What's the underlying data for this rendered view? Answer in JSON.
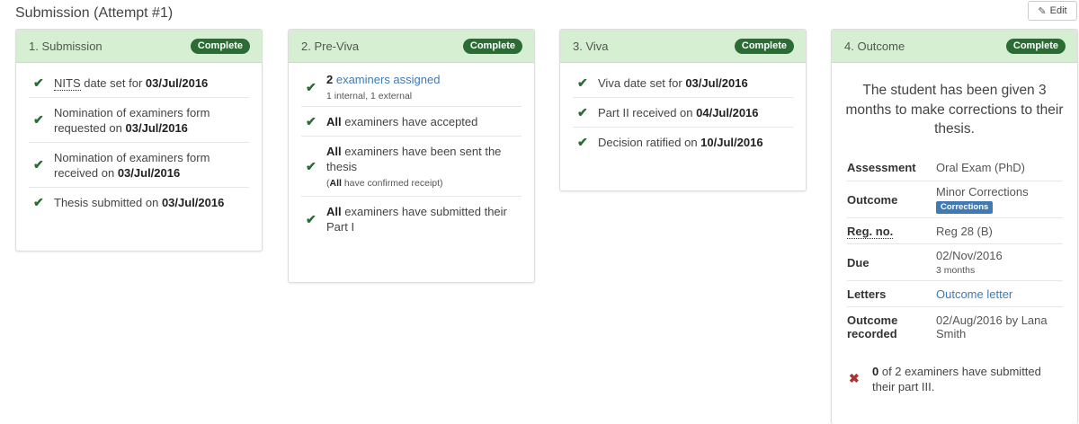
{
  "header": {
    "title": "Submission (Attempt #1)",
    "edit_label": "Edit"
  },
  "cards": [
    {
      "title": "1. Submission",
      "status": "Complete",
      "items": [
        {
          "pre_abbr": "NITS",
          "pre": " date set for ",
          "bold": "03/Jul/2016"
        },
        {
          "pre": "Nomination of examiners form requested on ",
          "bold": "03/Jul/2016"
        },
        {
          "pre": "Nomination of examiners form received on ",
          "bold": "03/Jul/2016"
        },
        {
          "pre": "Thesis submitted on ",
          "bold": "03/Jul/2016"
        }
      ]
    },
    {
      "title": "2. Pre-Viva",
      "status": "Complete",
      "items": [
        {
          "bold": "2",
          "link": " examiners assigned",
          "sub": "1 internal, 1 external"
        },
        {
          "bold": "All",
          "post": " examiners have accepted"
        },
        {
          "bold": "All",
          "post": " examiners have been sent the thesis",
          "sub_open": "(",
          "sub_bold": "All",
          "sub_rest": " have confirmed receipt)"
        },
        {
          "bold": "All",
          "post": " examiners have submitted their Part I"
        }
      ]
    },
    {
      "title": "3. Viva",
      "status": "Complete",
      "items": [
        {
          "pre": "Viva date set for ",
          "bold": "03/Jul/2016"
        },
        {
          "pre": "Part II received on ",
          "bold": "04/Jul/2016"
        },
        {
          "pre": "Decision ratified on ",
          "bold": "10/Jul/2016"
        }
      ]
    },
    {
      "title": "4. Outcome",
      "status": "Complete",
      "summary": "The student has been given 3 months to make corrections to their thesis.",
      "details": {
        "assessment_label": "Assessment",
        "assessment_value": "Oral Exam (PhD)",
        "outcome_label": "Outcome",
        "outcome_value": "Minor Corrections",
        "outcome_badge": "Corrections",
        "reg_label": "Reg. no.",
        "reg_value": "Reg 28 (B)",
        "due_label": "Due",
        "due_value": "02/Nov/2016",
        "due_sub": "3 months",
        "letters_label": "Letters",
        "letters_value": "Outcome letter",
        "recorded_label": "Outcome recorded",
        "recorded_value": "02/Aug/2016 by Lana Smith"
      },
      "footer_item": {
        "bold": "0",
        "post": " of 2 examiners have submitted their part III."
      }
    }
  ],
  "colors": {
    "header_bg": "#d6eed2",
    "complete_badge": "#2b6b34",
    "link": "#3f7ab5",
    "cross": "#a33333"
  },
  "icons": {
    "check": "check-icon",
    "cross": "cross-icon",
    "edit": "pencil-icon"
  }
}
